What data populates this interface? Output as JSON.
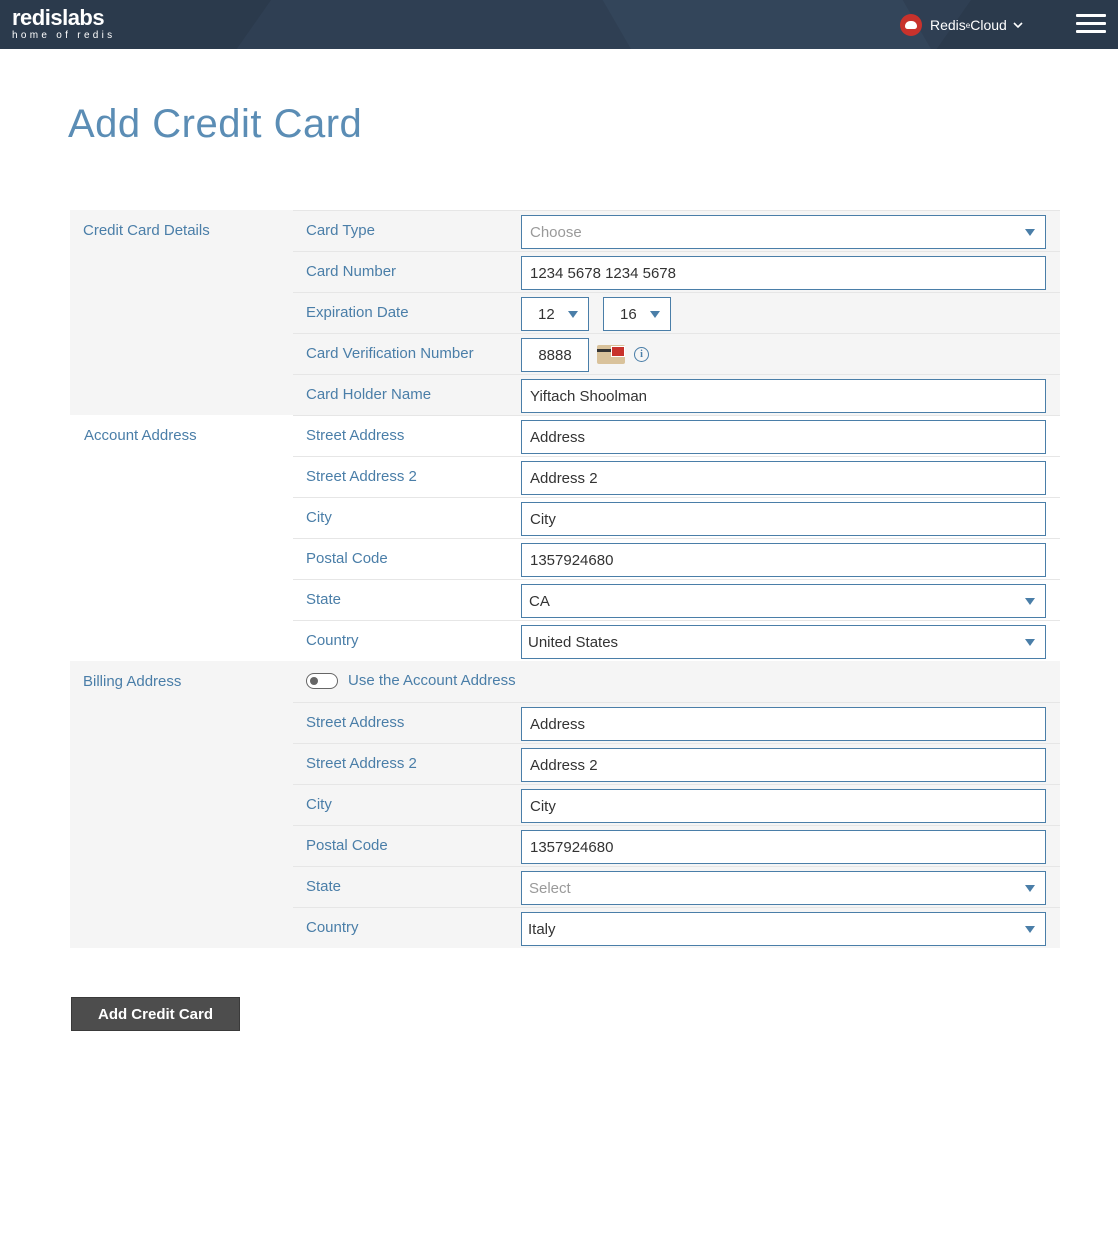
{
  "header": {
    "logo_main": "redislabs",
    "logo_sub": "home of redis",
    "product_label": "Redis",
    "product_sup": "e",
    "product_suffix": " Cloud"
  },
  "page": {
    "title": "Add Credit Card"
  },
  "credit_card": {
    "section_label": "Credit Card Details",
    "card_type_label": "Card Type",
    "card_type_value": "Choose",
    "card_number_label": "Card Number",
    "card_number_value": "1234 5678 1234 5678",
    "expiration_label": "Expiration Date",
    "exp_month": "12",
    "exp_year": "16",
    "cvv_label": "Card Verification Number",
    "cvv_value": "8888",
    "holder_label": "Card Holder Name",
    "holder_value": "Yiftach Shoolman"
  },
  "account_address": {
    "section_label": "Account Address",
    "street_label": "Street Address",
    "street_value": "Address",
    "street2_label": "Street Address 2",
    "street2_value": "Address 2",
    "city_label": "City",
    "city_value": "City",
    "postal_label": "Postal Code",
    "postal_value": "1357924680",
    "state_label": "State",
    "state_value": "CA",
    "country_label": "Country",
    "country_value": "United States"
  },
  "billing_address": {
    "section_label": "Billing Address",
    "toggle_label": "Use the Account Address",
    "street_label": "Street Address",
    "street_value": "Address",
    "street2_label": "Street Address 2",
    "street2_value": "Address 2",
    "city_label": "City",
    "city_value": "City",
    "postal_label": "Postal Code",
    "postal_value": "1357924680",
    "state_label": "State",
    "state_value": "Select",
    "country_label": "Country",
    "country_value": "Italy"
  },
  "actions": {
    "submit_label": "Add Credit Card"
  },
  "colors": {
    "header_bg": "#2b3a4c",
    "accent": "#4a7ea8",
    "title": "#5b8db5",
    "button": "#4d4d4d",
    "brand_red": "#c8322c"
  }
}
